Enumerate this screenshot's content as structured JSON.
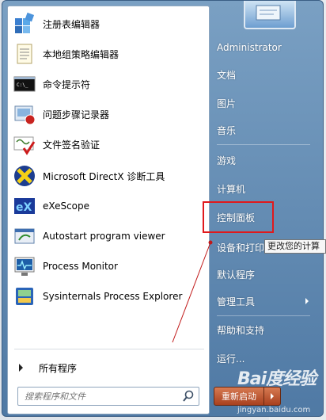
{
  "programs": [
    {
      "label": "注册表编辑器",
      "icon": "registry-editor-icon"
    },
    {
      "label": "本地组策略编辑器",
      "icon": "group-policy-icon"
    },
    {
      "label": "命令提示符",
      "icon": "command-prompt-icon"
    },
    {
      "label": "问题步骤记录器",
      "icon": "steps-recorder-icon"
    },
    {
      "label": "文件签名验证",
      "icon": "file-signature-icon"
    },
    {
      "label": "Microsoft DirectX 诊断工具",
      "icon": "directx-icon"
    },
    {
      "label": "eXeScope",
      "icon": "exescope-icon"
    },
    {
      "label": "Autostart program viewer",
      "icon": "autostart-viewer-icon"
    },
    {
      "label": "Process Monitor",
      "icon": "process-monitor-icon"
    },
    {
      "label": "Sysinternals Process Explorer",
      "icon": "process-explorer-icon"
    }
  ],
  "all_programs": "所有程序",
  "search": {
    "placeholder": "搜索程序和文件"
  },
  "right_items": [
    {
      "label": "Administrator",
      "submenu": false
    },
    {
      "label": "文档",
      "submenu": false
    },
    {
      "label": "图片",
      "submenu": false
    },
    {
      "label": "音乐",
      "submenu": false
    },
    {
      "label": "游戏",
      "submenu": false
    },
    {
      "label": "计算机",
      "submenu": false
    },
    {
      "label": "控制面板",
      "submenu": false
    },
    {
      "label": "设备和打印",
      "submenu": false
    },
    {
      "label": "默认程序",
      "submenu": false
    },
    {
      "label": "管理工具",
      "submenu": true
    },
    {
      "label": "帮助和支持",
      "submenu": false
    },
    {
      "label": "运行...",
      "submenu": false
    }
  ],
  "tooltip": "更改您的计算",
  "shutdown": "重新启动",
  "watermark": {
    "logo": "Bai度经验",
    "url": "jingyan.baidu.com"
  },
  "colors": {
    "highlight": "#e0191c",
    "menu_blue": "#5a82ad"
  }
}
